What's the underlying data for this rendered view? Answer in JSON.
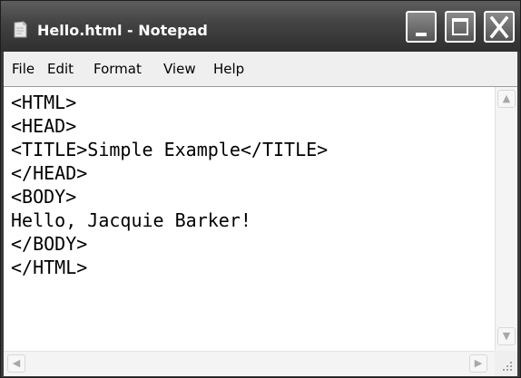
{
  "window": {
    "title": "Hello.html - Notepad"
  },
  "menu": [
    "File",
    "Edit",
    "Format",
    "View",
    "Help"
  ],
  "editor": {
    "lines": [
      "<HTML>",
      "<HEAD>",
      "<TITLE>Simple Example</TITLE>",
      "</HEAD>",
      "<BODY>",
      "Hello, Jacquie Barker!",
      "</BODY>",
      "</HTML>"
    ]
  },
  "icons": {
    "app": "notepad-icon",
    "minimize": "minimize-icon",
    "maximize": "maximize-icon",
    "close": "close-icon",
    "scroll_up": "chevron-up-icon",
    "scroll_down": "chevron-down-icon",
    "scroll_left": "chevron-left-icon",
    "scroll_right": "chevron-right-icon",
    "grip": "resize-grip-icon"
  }
}
